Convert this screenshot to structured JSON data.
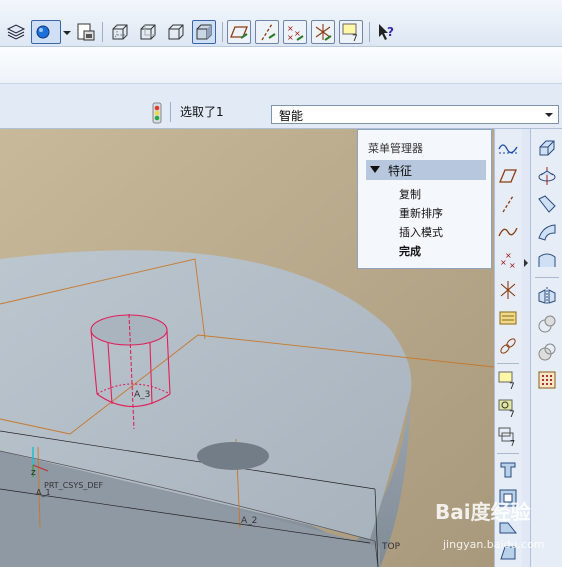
{
  "toolbar": {
    "icons": [
      "layers-icon",
      "display-style-dropdown-icon",
      "saved-views-icon",
      "view-wireframe-icon",
      "view-hidden-line-icon",
      "view-no-hidden-icon",
      "view-shaded-icon",
      "datum-plane-toggle-icon",
      "datum-axis-toggle-icon",
      "datum-point-toggle-icon",
      "csys-toggle-icon",
      "annotation-toggle-icon",
      "context-help-icon"
    ]
  },
  "status": {
    "selected_text": "选取了1"
  },
  "filter": {
    "value": "智能"
  },
  "menu_manager": {
    "title": "菜单管理器",
    "section": "特征",
    "items": [
      "复制",
      "重新排序",
      "插入模式",
      "完成"
    ]
  },
  "model_labels": {
    "axis_a3": "A_3",
    "axis_a2": "A_2",
    "csys": "PRT_CSYS_DEF",
    "axis_a1": "A_1",
    "plane_top": "TOP"
  },
  "watermark": {
    "brand": "Bai度经验",
    "url": "jingyan.baidu.com"
  },
  "colors": {
    "background_bronze": "#b9a88a",
    "part_gray": "#a9b5c0",
    "selected_red": "#e0205a",
    "datum_orange": "#c8782a"
  }
}
